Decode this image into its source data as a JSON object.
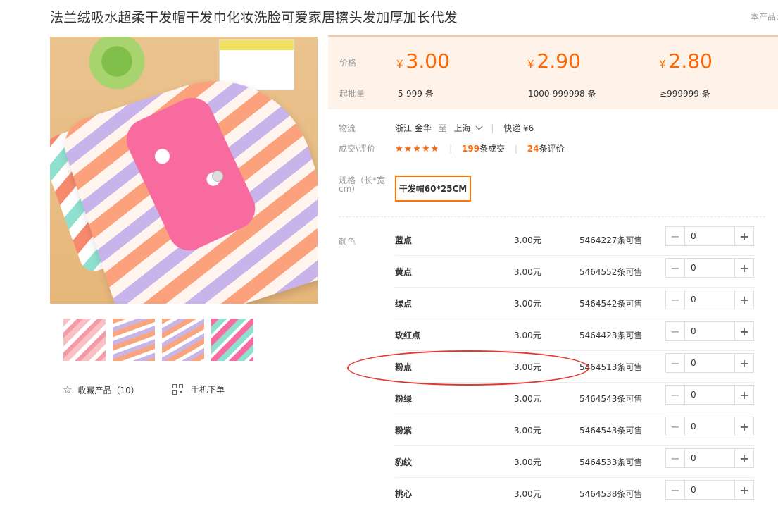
{
  "product": {
    "title": "法兰绒吸水超柔干发帽干发巾化妆洗脸可爱家居擦头发加厚加长代发",
    "this_product_label": "本产品:"
  },
  "gallery": {
    "thumb_count": 4
  },
  "actions": {
    "favorite_label": "收藏产品（10）",
    "mobile_order_label": "手机下单"
  },
  "pricing": {
    "price_label": "价格",
    "moq_label": "起批量",
    "currency": "¥",
    "unit": "条",
    "tiers": [
      {
        "price": "3.00",
        "range": "5-999"
      },
      {
        "price": "2.90",
        "range": "1000-999998"
      },
      {
        "price": "2.80",
        "range": "≥999999"
      }
    ]
  },
  "logistics": {
    "label": "物流",
    "origin": "浙江 金华",
    "to": "至",
    "destination": "上海",
    "shipping": "快递 ¥6"
  },
  "reviews": {
    "label": "成交\\评价",
    "stars": "★★★★★",
    "deals_count": "199",
    "deals_text": "条成交",
    "review_count": "24",
    "review_text": "条评价"
  },
  "spec": {
    "label": "规格（长*宽cm）",
    "option": "干发帽60*25CM"
  },
  "colors": {
    "label": "颜色",
    "items": [
      {
        "name": "蓝点",
        "price": "3.00元",
        "stock": "5464227条可售",
        "qty": "0"
      },
      {
        "name": "黄点",
        "price": "3.00元",
        "stock": "5464552条可售",
        "qty": "0"
      },
      {
        "name": "绿点",
        "price": "3.00元",
        "stock": "5464542条可售",
        "qty": "0"
      },
      {
        "name": "玫红点",
        "price": "3.00元",
        "stock": "5464423条可售",
        "qty": "0"
      },
      {
        "name": "粉点",
        "price": "3.00元",
        "stock": "5464513条可售",
        "qty": "0"
      },
      {
        "name": "粉绿",
        "price": "3.00元",
        "stock": "5464543条可售",
        "qty": "0"
      },
      {
        "name": "粉紫",
        "price": "3.00元",
        "stock": "5464543条可售",
        "qty": "0"
      },
      {
        "name": "豹纹",
        "price": "3.00元",
        "stock": "5464533条可售",
        "qty": "0"
      },
      {
        "name": "桃心",
        "price": "3.00元",
        "stock": "5464538条可售",
        "qty": "0"
      }
    ]
  },
  "theme": {
    "accent": "#ff6600",
    "spec_border": "#ff7300",
    "annotation": "#e0382f"
  }
}
